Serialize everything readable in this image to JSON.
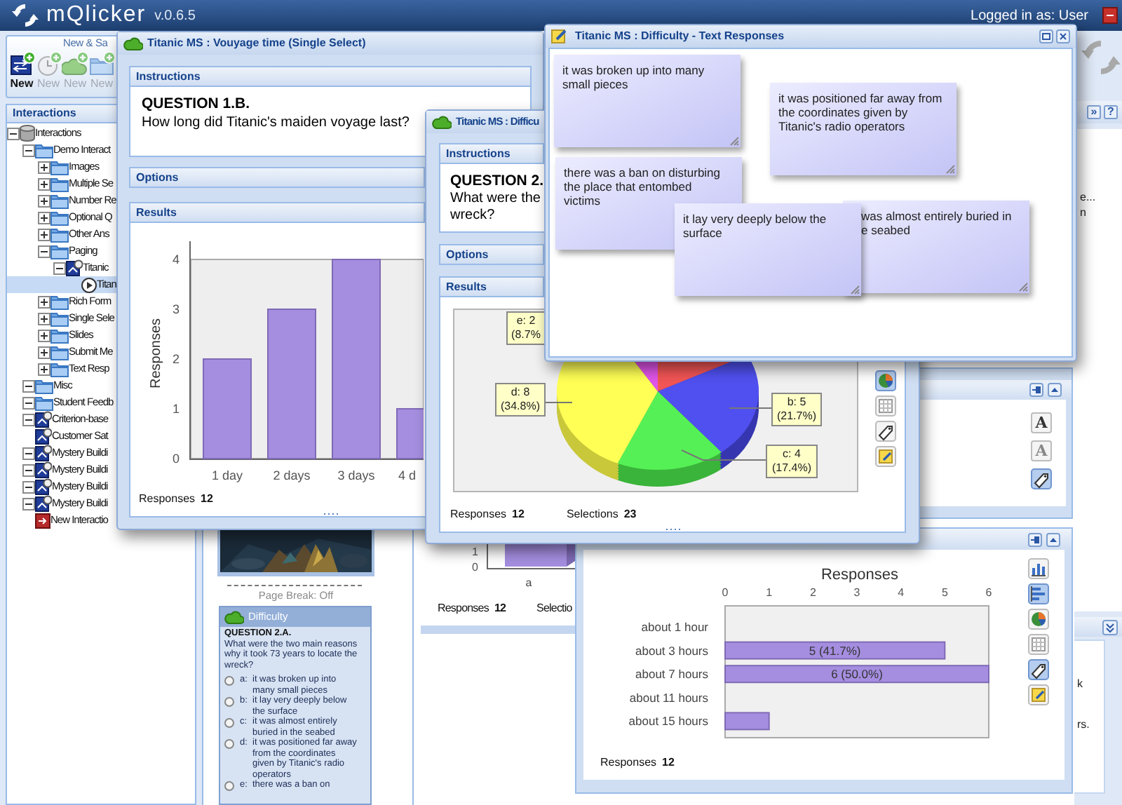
{
  "app": {
    "logo": "mQlicker",
    "version": "v.0.6.5",
    "user": "Logged in as: User"
  },
  "toolbar": {
    "title": "New & Sa",
    "buttons": [
      {
        "kind": "session",
        "label": "New",
        "disabled": false
      },
      {
        "kind": "timer",
        "label": "New",
        "disabled": true
      },
      {
        "kind": "interaction",
        "label": "New",
        "disabled": true
      },
      {
        "kind": "folder",
        "label": "New",
        "disabled": true
      }
    ]
  },
  "tree": {
    "title": "Interactions",
    "items": [
      {
        "label": "Interactions",
        "kind": "database",
        "expanded": true,
        "selected": false,
        "children": [
          {
            "label": "Demo Interact",
            "kind": "folder",
            "expanded": true,
            "selected": false,
            "children": [
              {
                "label": "Images",
                "kind": "folder",
                "expanded": false,
                "selected": false
              },
              {
                "label": "Multiple Se",
                "kind": "folder",
                "expanded": false,
                "selected": false
              },
              {
                "label": "Number Re",
                "kind": "folder",
                "expanded": false,
                "selected": false
              },
              {
                "label": "Optional Q",
                "kind": "folder",
                "expanded": false,
                "selected": false
              },
              {
                "label": "Other Ans",
                "kind": "folder",
                "expanded": false,
                "selected": false
              },
              {
                "label": "Paging",
                "kind": "folder",
                "expanded": true,
                "selected": false,
                "children": [
                  {
                    "label": "Titanic",
                    "kind": "session",
                    "expanded": true,
                    "selected": false,
                    "children": [
                      {
                        "label": "Titan",
                        "kind": "play",
                        "selected": true
                      }
                    ]
                  }
                ]
              },
              {
                "label": "Rich Form",
                "kind": "folder",
                "expanded": false,
                "selected": false
              },
              {
                "label": "Single Sele",
                "kind": "folder",
                "expanded": false,
                "selected": false
              },
              {
                "label": "Slides",
                "kind": "folder",
                "expanded": false,
                "selected": false
              },
              {
                "label": "Submit Me",
                "kind": "folder",
                "expanded": false,
                "selected": false
              },
              {
                "label": "Text Resp",
                "kind": "folder",
                "expanded": false,
                "selected": false
              }
            ]
          },
          {
            "label": "Misc",
            "kind": "folder",
            "expanded": true,
            "selected": false
          },
          {
            "label": "Student Feedb",
            "kind": "folder",
            "expanded": true,
            "selected": false
          },
          {
            "label": "Criterion-base",
            "kind": "session",
            "expanded": true,
            "selected": false
          },
          {
            "label": "Customer Sat",
            "kind": "session",
            "selected": false
          },
          {
            "label": "Mystery Buildi",
            "kind": "session",
            "expanded": true,
            "selected": false
          },
          {
            "label": "Mystery Buildi",
            "kind": "session",
            "expanded": true,
            "selected": false
          },
          {
            "label": "Mystery Buildi",
            "kind": "session",
            "expanded": true,
            "selected": false
          },
          {
            "label": "Mystery Buildi",
            "kind": "session",
            "expanded": true,
            "selected": false
          },
          {
            "label": "New Interactio",
            "kind": "new",
            "selected": false
          }
        ]
      }
    ]
  },
  "preview": {
    "page_break": "Page Break: Off",
    "card": {
      "title": "Difficulty",
      "question": "QUESTION 2.A.",
      "text": "What were the two main reasons why it took 73 years to locate the wreck?",
      "options": [
        {
          "letter": "a:",
          "text": "it was broken up into many small pieces",
          "checked": false
        },
        {
          "letter": "b:",
          "text": "it lay very deeply below the surface",
          "checked": false
        },
        {
          "letter": "c:",
          "text": "it was almost entirely buried in the seabed",
          "checked": false
        },
        {
          "letter": "d:",
          "text": "it was positioned far away from the coordinates given by Titanic's radio operators",
          "checked": false
        },
        {
          "letter": "e:",
          "text": "there was a ban on",
          "checked": false
        }
      ]
    }
  },
  "partial_chart": {
    "ticks": [
      "1",
      "0"
    ],
    "category": "a",
    "stats": [
      {
        "label": "Responses",
        "value": "12"
      },
      {
        "label": "Selectio"
      }
    ]
  },
  "format_panel": {
    "tools": [
      {
        "kind": "grow",
        "glyph": "A",
        "selected": false
      },
      {
        "kind": "shrink",
        "glyph": "A",
        "selected": false
      },
      {
        "kind": "tag",
        "selected": true
      }
    ]
  },
  "bar_panel": {
    "chart_data": {
      "type": "bar",
      "orientation": "horizontal",
      "title": "Responses",
      "categories": [
        "about 1 hour",
        "about 3 hours",
        "about 7 hours",
        "about 11 hours",
        "about 15 hours"
      ],
      "values": [
        0,
        5,
        6,
        0,
        1
      ],
      "xticks": [
        0,
        1,
        2,
        3,
        4,
        5,
        6
      ],
      "xlim": [
        0,
        6
      ],
      "value_labels": [
        null,
        "5 (41.7%)",
        "6 (50.0%)",
        null,
        null
      ]
    },
    "stats": [
      {
        "label": "Responses",
        "value": "12"
      }
    ],
    "tools": [
      {
        "kind": "column",
        "selected": false
      },
      {
        "kind": "hbar",
        "selected": true
      },
      {
        "kind": "pie",
        "selected": false
      },
      {
        "kind": "table",
        "selected": false
      },
      {
        "kind": "tag",
        "selected": true
      },
      {
        "kind": "note",
        "selected": false
      }
    ]
  },
  "right_column": {
    "buttons": [
      "»",
      "?"
    ],
    "fragments": [
      "e...",
      "n"
    ],
    "lower_fragments": [
      "k",
      "rs."
    ]
  },
  "voyage_window": {
    "title": "Titanic MS : Vouyage time (Single Select)",
    "instructions_title": "Instructions",
    "question": "QUESTION 1.B.",
    "question_text": "How long did Titanic's maiden voyage last?",
    "options_title": "Options",
    "results_title": "Results",
    "chart_data": {
      "type": "bar",
      "ylabel": "Responses",
      "categories": [
        "1 day",
        "2 days",
        "3 days",
        "4 d"
      ],
      "values": [
        2,
        3,
        4,
        1
      ],
      "yticks": [
        0,
        1,
        2,
        3,
        4
      ],
      "ylim": [
        0,
        4
      ]
    },
    "stats": [
      {
        "label": "Responses",
        "value": "12"
      }
    ]
  },
  "difficulty_window": {
    "title": "Titanic MS : Difficu",
    "instructions_title": "Instructions",
    "question": "QUESTION 2.",
    "question_lines": [
      "What were the",
      "wreck?"
    ],
    "options_title": "Options",
    "results_title": "Results",
    "pie_labels": [
      {
        "lines": [
          "e: 2",
          "(8.7%"
        ]
      },
      {
        "lines": [
          "d: 8",
          "(34.8%)"
        ]
      },
      {
        "lines": [
          "b: 5",
          "(21.7%)"
        ]
      },
      {
        "lines": [
          "c: 4",
          "(17.4%)"
        ]
      }
    ],
    "tools": [
      {
        "kind": "pie",
        "selected": true
      },
      {
        "kind": "table",
        "selected": false
      },
      {
        "kind": "tag",
        "selected": false
      },
      {
        "kind": "note",
        "selected": false
      }
    ],
    "stats": [
      {
        "label": "Responses",
        "value": "12"
      },
      {
        "label": "Selections",
        "value": "23"
      }
    ]
  },
  "text_responses_window": {
    "title": "Titanic MS : Difficulty - Text Responses",
    "notes": [
      {
        "lines": [
          "it was broken up into many",
          "small pieces"
        ]
      },
      {
        "lines": [
          "it was positioned far away from",
          "the coordinates given by",
          "Titanic's radio operators"
        ]
      },
      {
        "lines": [
          "there was a ban on disturbing",
          "the place that entombed",
          "victims"
        ]
      },
      {
        "lines": [
          "it lay very deeply below the",
          "surface"
        ]
      },
      {
        "lines": [
          "was almost entirely buried in",
          "e seabed"
        ]
      }
    ]
  }
}
